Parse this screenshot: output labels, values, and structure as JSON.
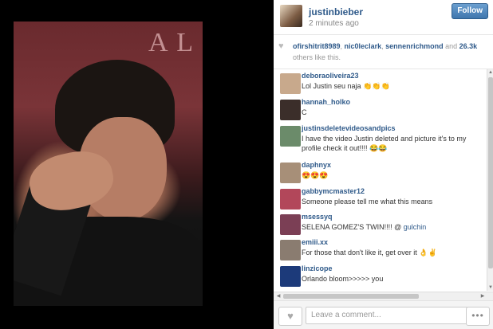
{
  "post": {
    "username": "justinbieber",
    "time": "2 minutes ago",
    "follow_label": "Follow",
    "image_text": "A L",
    "likes": {
      "users": [
        "ofirshitrit8989",
        "nic0leclark",
        "sennenrichmond"
      ],
      "separator": ", ",
      "and_text": " and ",
      "count": "26.3k",
      "suffix": "others like this."
    }
  },
  "comments": [
    {
      "user": "deboraoliveira23",
      "text": "Lol Justin seu naja 👏👏👏",
      "avatar_color": "#c8a98c"
    },
    {
      "user": "hannah_holko",
      "text": "C",
      "avatar_color": "#3b2e2a"
    },
    {
      "user": "justinsdeletevideosandpics",
      "text": "I have the video Justin deleted and picture it's to my profile check it out!!!! 😂😂",
      "avatar_color": "#6b8b6a"
    },
    {
      "user": "daphnyx",
      "text": "😍😍😍",
      "avatar_color": "#a78f78"
    },
    {
      "user": "gabbymcmaster12",
      "text": "Someone please tell me what this means",
      "avatar_color": "#b2475a"
    },
    {
      "user": "msessyq",
      "text": "SELENA GOMEZ'S TWIN!!!! @",
      "mention": "gulchin",
      "avatar_color": "#7b3f55"
    },
    {
      "user": "emiii.xx",
      "text": "For those that don't like it, get over it 👌✌",
      "avatar_color": "#8a7c70"
    },
    {
      "user": "linzicope",
      "text": "Orlando bloom>>>>> you",
      "avatar_color": "#1c3a7a"
    }
  ],
  "composer": {
    "placeholder": "Leave a comment...",
    "more_label": "•••",
    "like_icon": "heart-icon"
  },
  "colors": {
    "link": "#2f5a8a",
    "follow_button": "#4a80b8"
  }
}
